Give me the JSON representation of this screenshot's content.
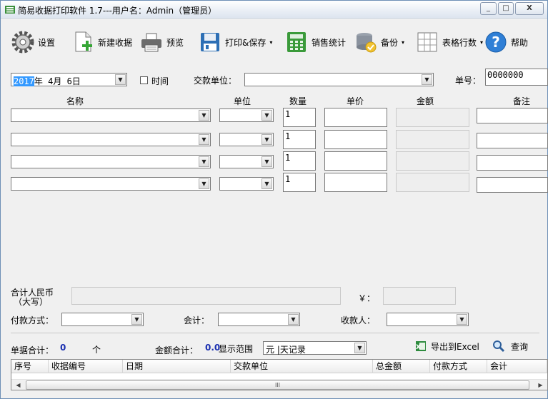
{
  "window": {
    "title": "简易收据打印软件 1.7---用户名：Admin（管理员）",
    "minimize": "_",
    "maximize": "□",
    "close": "X"
  },
  "toolbar": {
    "settings": "设置",
    "new_receipt": "新建收据",
    "preview": "预览",
    "print_save": "打印&保存",
    "sales_stats": "销售统计",
    "backup": "备份",
    "table_rows": "表格行数",
    "help": "帮助",
    "dropdown_caret": "▾"
  },
  "form": {
    "date_year": "2017",
    "date_rest": "年  4月  6日",
    "time_label": "时间",
    "payer_label": "交款单位：",
    "payer_value": "",
    "receipt_no_label": "单号：",
    "receipt_no_value": "0000000"
  },
  "columns": {
    "name": "名称",
    "unit": "单位",
    "quantity": "数量",
    "price": "单价",
    "amount": "金额",
    "note": "备注"
  },
  "items": [
    {
      "quantity": "1"
    },
    {
      "quantity": "1"
    },
    {
      "quantity": "1"
    },
    {
      "quantity": "1"
    }
  ],
  "totals": {
    "rmb_label_line1": "合计人民币",
    "rmb_label_line2": "（大写）",
    "yen_label": "￥：",
    "payment_method_label": "付款方式：",
    "accountant_label": "会计：",
    "payee_label": "收款人："
  },
  "summary": {
    "receipt_count_label": "单据合计：",
    "receipt_count_value": "0",
    "receipt_count_unit": "个",
    "amount_total_label": "金额合计：",
    "amount_total_value": "0.0",
    "display_range_label": "显示范围",
    "display_range_value": "元 |天记录",
    "export_excel": "导出到Excel",
    "query": "查询"
  },
  "grid_headers": [
    "序号",
    "收据编号",
    "日期",
    "交款单位",
    "总金额",
    "付款方式",
    "会计"
  ],
  "scroll": {
    "left": "◀",
    "right": "▶",
    "thumb": "III"
  },
  "combo_arrow": "▼"
}
